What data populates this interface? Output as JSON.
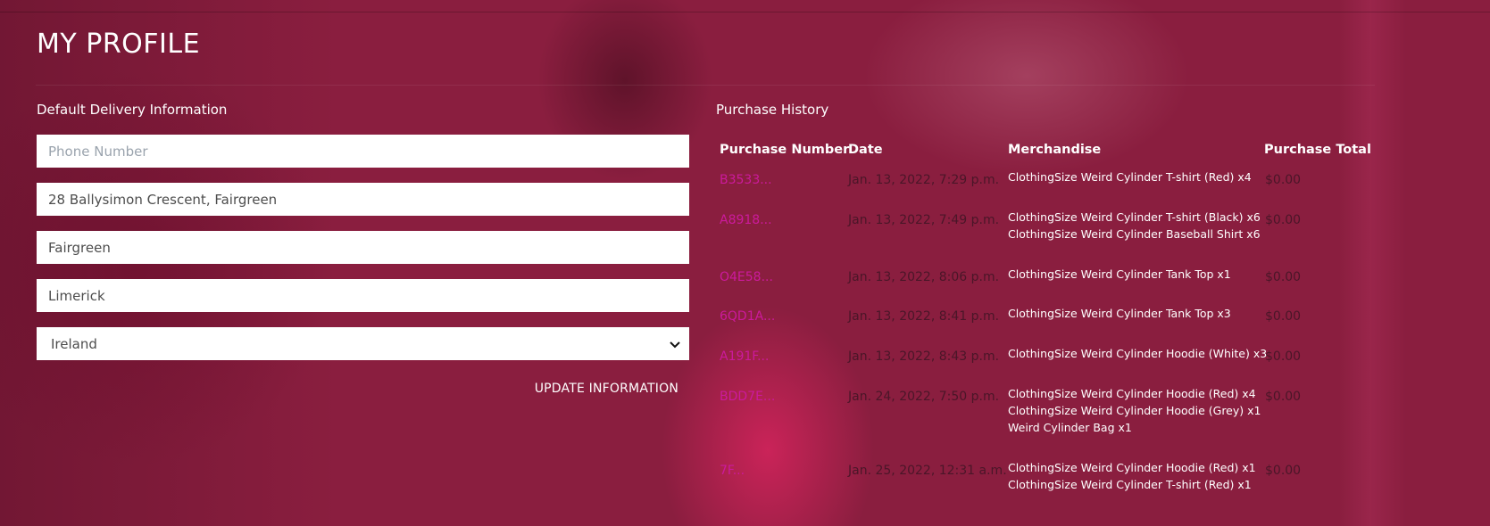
{
  "page": {
    "title": "MY PROFILE"
  },
  "delivery": {
    "heading": "Default Delivery Information",
    "phone_placeholder": "Phone Number",
    "street": "28 Ballysimon Crescent, Fairgreen",
    "town": "Fairgreen",
    "county": "Limerick",
    "country": "Ireland",
    "update_label": "UPDATE INFORMATION"
  },
  "history": {
    "heading": "Purchase History",
    "columns": [
      "Purchase Number",
      "Date",
      "Merchandise",
      "Purchase Total"
    ],
    "orders": [
      {
        "number": "B3533...",
        "date": "Jan. 13, 2022, 7:29 p.m.",
        "items": [
          "ClothingSize Weird Cylinder T-shirt (Red) x4"
        ],
        "total": "$0.00"
      },
      {
        "number": "A8918...",
        "date": "Jan. 13, 2022, 7:49 p.m.",
        "items": [
          "ClothingSize Weird Cylinder T-shirt (Black) x6",
          "ClothingSize Weird Cylinder Baseball Shirt x6"
        ],
        "total": "$0.00"
      },
      {
        "number": "O4E58...",
        "date": "Jan. 13, 2022, 8:06 p.m.",
        "items": [
          "ClothingSize Weird Cylinder Tank Top x1"
        ],
        "total": "$0.00"
      },
      {
        "number": "6QD1A...",
        "date": "Jan. 13, 2022, 8:41 p.m.",
        "items": [
          "ClothingSize Weird Cylinder Tank Top x3"
        ],
        "total": "$0.00"
      },
      {
        "number": "A191F...",
        "date": "Jan. 13, 2022, 8:43 p.m.",
        "items": [
          "ClothingSize Weird Cylinder Hoodie (White) x3"
        ],
        "total": "$0.00"
      },
      {
        "number": "BDD7E...",
        "date": "Jan. 24, 2022, 7:50 p.m.",
        "items": [
          "ClothingSize Weird Cylinder Hoodie (Red) x4",
          "ClothingSize Weird Cylinder Hoodie (Grey) x1",
          "Weird Cylinder Bag x1"
        ],
        "total": "$0.00"
      },
      {
        "number": "7F...",
        "date": "Jan. 25, 2022, 12:31 a.m.",
        "items": [
          "ClothingSize Weird Cylinder Hoodie (Red) x1",
          "ClothingSize Weird Cylinder T-shirt (Red) x1"
        ],
        "total": "$0.00"
      }
    ]
  },
  "colors": {
    "background": "#8a1e3f",
    "link": "#cc1a9c",
    "muted_text": "#4a1628",
    "accent_glow": "#ff2870"
  },
  "icons": {
    "country_select": "chevron-down-icon"
  }
}
